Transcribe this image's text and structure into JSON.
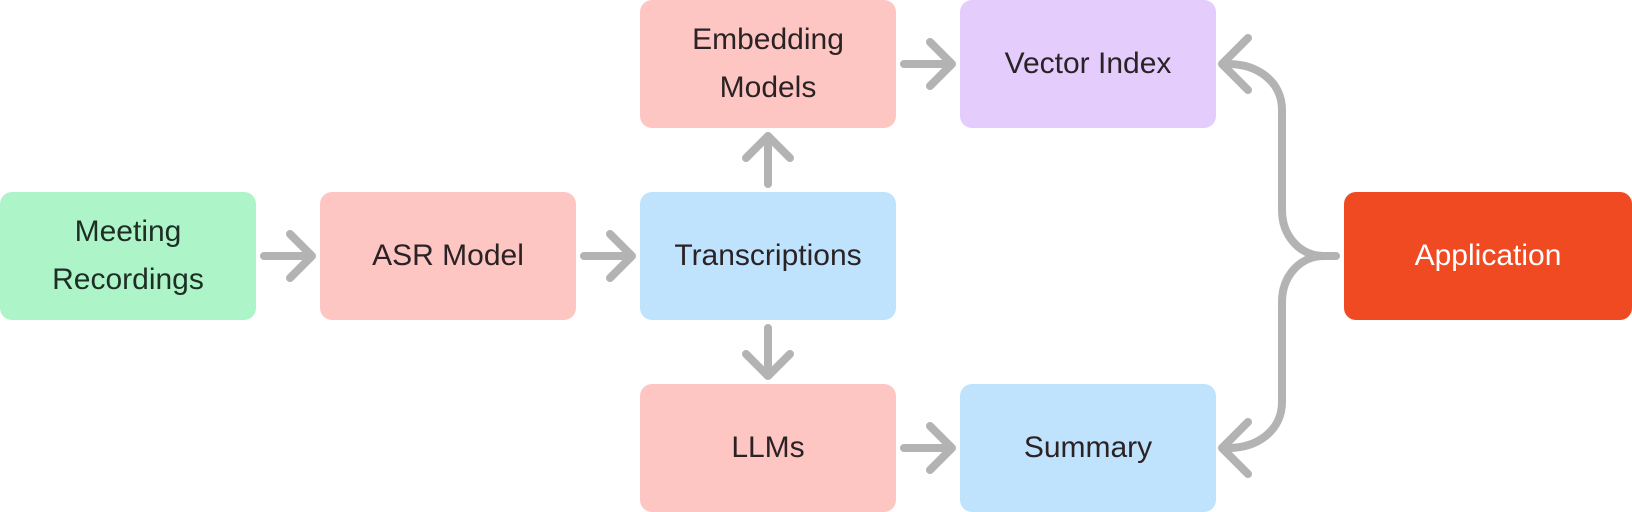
{
  "diagram": {
    "type": "flowchart",
    "edge_color": "#b3b3b3",
    "nodes": {
      "meeting_recordings": {
        "label": "Meeting\nRecordings",
        "color": "#aef4c9"
      },
      "asr_model": {
        "label": "ASR Model",
        "color": "#fec6c2"
      },
      "transcriptions": {
        "label": "Transcriptions",
        "color": "#bfe3fd"
      },
      "embedding_models": {
        "label": "Embedding\nModels",
        "color": "#fec6c2"
      },
      "llms": {
        "label": "LLMs",
        "color": "#fec6c2"
      },
      "vector_index": {
        "label": "Vector Index",
        "color": "#e4cdfd"
      },
      "summary": {
        "label": "Summary",
        "color": "#bfe3fd"
      },
      "application": {
        "label": "Application",
        "color": "#f04a23"
      }
    },
    "edges": [
      {
        "from": "meeting_recordings",
        "to": "asr_model"
      },
      {
        "from": "asr_model",
        "to": "transcriptions"
      },
      {
        "from": "transcriptions",
        "to": "embedding_models"
      },
      {
        "from": "transcriptions",
        "to": "llms"
      },
      {
        "from": "embedding_models",
        "to": "vector_index"
      },
      {
        "from": "llms",
        "to": "summary"
      },
      {
        "from": "application",
        "to": "vector_index"
      },
      {
        "from": "application",
        "to": "summary"
      }
    ]
  }
}
